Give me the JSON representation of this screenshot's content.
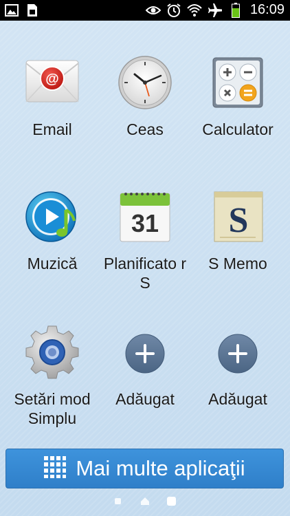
{
  "status_bar": {
    "time": "16:09"
  },
  "apps": [
    {
      "label": "Email",
      "icon": "email-icon"
    },
    {
      "label": "Ceas",
      "icon": "clock-icon"
    },
    {
      "label": "Calculator",
      "icon": "calculator-icon"
    },
    {
      "label": "Muzică",
      "icon": "music-icon"
    },
    {
      "label": "Planificato r S",
      "icon": "calendar-icon",
      "calendar_day": "31"
    },
    {
      "label": "S Memo",
      "icon": "memo-icon",
      "memo_letter": "S"
    },
    {
      "label": "Setări mod Simplu",
      "icon": "settings-icon"
    },
    {
      "label": "Adăugat",
      "icon": "add-icon"
    },
    {
      "label": "Adăugat",
      "icon": "add-icon"
    }
  ],
  "more_apps_button": {
    "label": "Mai multe aplicaţii"
  },
  "colors": {
    "accent": "#3a8ad6",
    "background": "#c9def0"
  }
}
